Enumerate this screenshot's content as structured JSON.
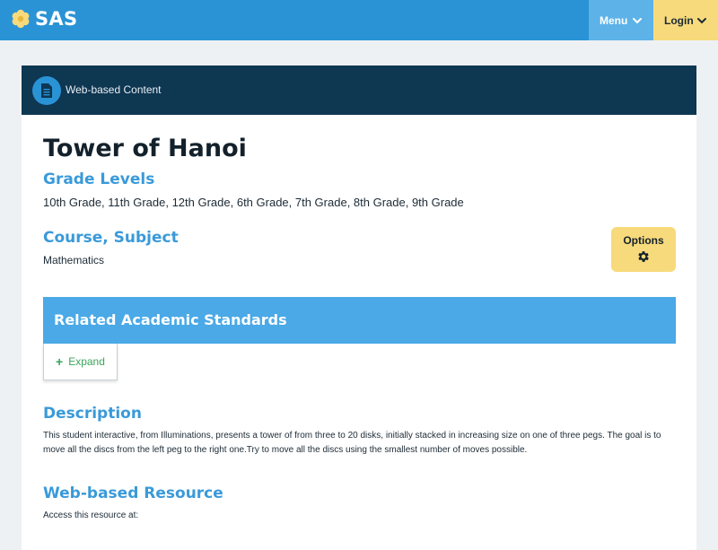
{
  "header": {
    "logo_text": "SAS",
    "logo_icon": "flower-logo-icon",
    "menu_label": "Menu",
    "login_label": "Login"
  },
  "card": {
    "type_label": "Web-based Content",
    "type_icon": "document-icon",
    "title": "Tower of Hanoi",
    "grade_levels_heading": "Grade Levels",
    "grade_levels": "10th Grade, 11th Grade, 12th Grade, 6th Grade, 7th Grade, 8th Grade, 9th Grade",
    "course_heading": "Course, Subject",
    "course_value": "Mathematics",
    "options_label": "Options",
    "options_icon": "gear-icon",
    "standards_heading": "Related Academic Standards",
    "expand_label": "Expand",
    "description_heading": "Description",
    "description_text": "This student interactive, from Illuminations, presents a tower of from three to 20 disks, initially stacked in increasing size on one of three pegs. The goal is to move all the discs from the left peg to the right one.Try to move all the discs using the smallest number of moves possible.",
    "resource_heading": "Web-based Resource",
    "resource_text": "Access this resource at:"
  },
  "colors": {
    "topbar": "#2a93d5",
    "menu": "#5db2e8",
    "login": "#f7da7b",
    "card_header": "#0e3752",
    "heading_blue": "#3a9ad9",
    "standards_bar": "#4aa9e6",
    "expand_green": "#3aa55b"
  }
}
